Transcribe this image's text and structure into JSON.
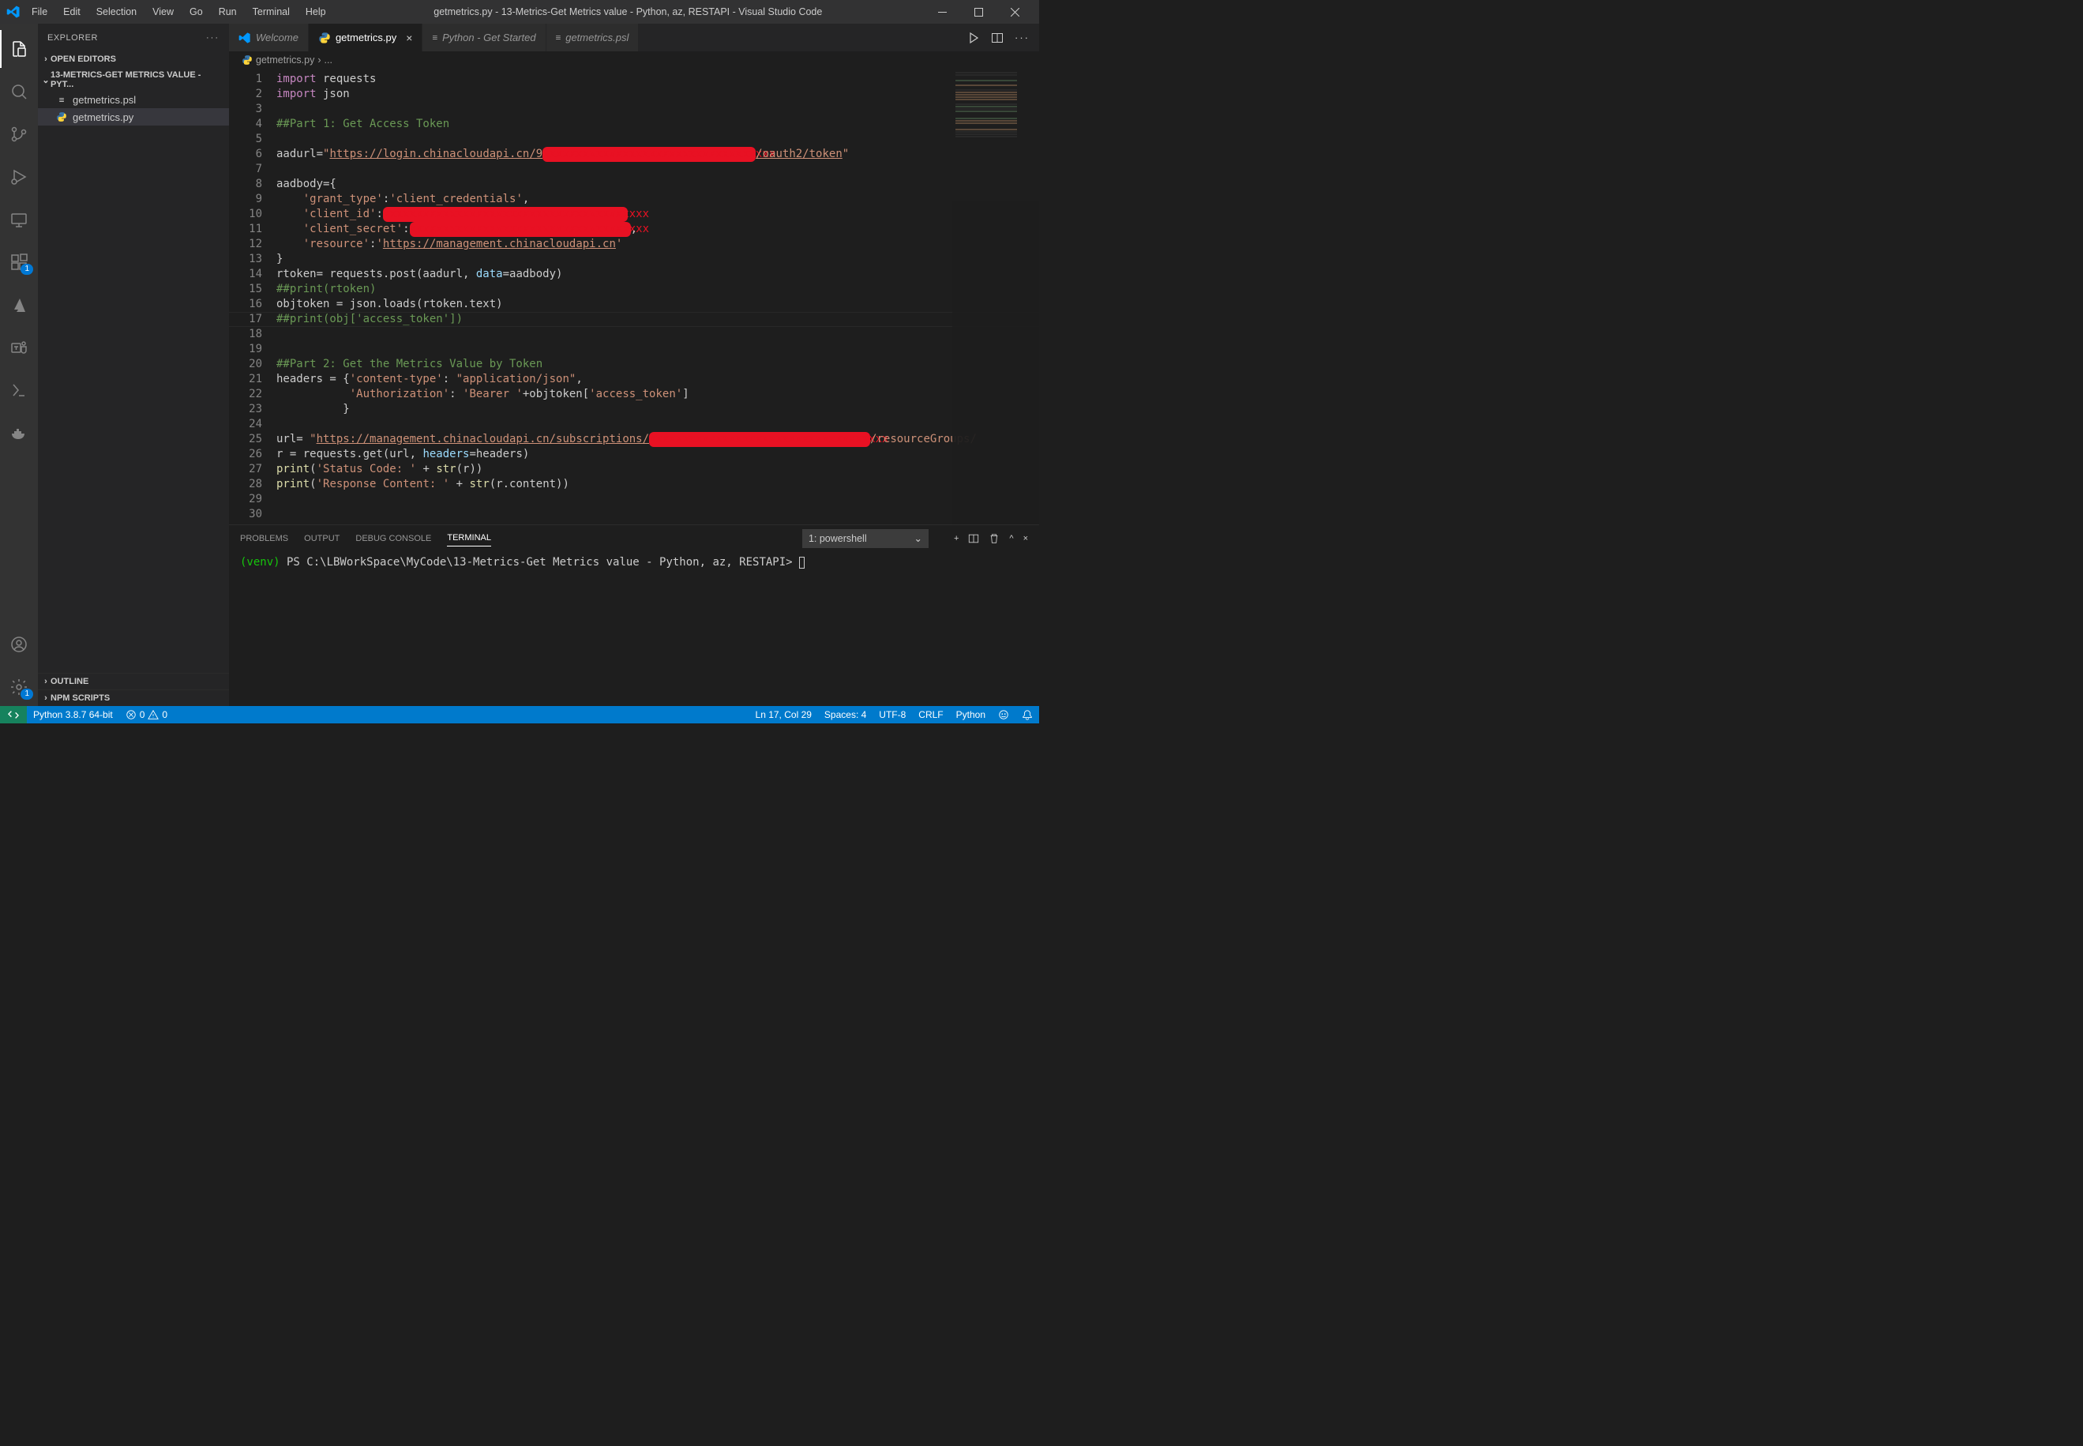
{
  "window": {
    "title": "getmetrics.py - 13-Metrics-Get Metrics value - Python, az, RESTAPI - Visual Studio Code"
  },
  "menu": {
    "file": "File",
    "edit": "Edit",
    "selection": "Selection",
    "view": "View",
    "go": "Go",
    "run": "Run",
    "terminal": "Terminal",
    "help": "Help"
  },
  "explorer": {
    "title": "EXPLORER",
    "open_editors": "OPEN EDITORS",
    "folder": "13-METRICS-GET METRICS VALUE - PYT...",
    "files": [
      {
        "name": "getmetrics.psl",
        "active": false,
        "icon": "≡"
      },
      {
        "name": "getmetrics.py",
        "active": true,
        "icon": "py"
      }
    ],
    "outline": "OUTLINE",
    "npm": "NPM SCRIPTS"
  },
  "tabs": {
    "items": [
      {
        "label": "Welcome",
        "icon": "vs",
        "active": false,
        "italic": true
      },
      {
        "label": "getmetrics.py",
        "icon": "py",
        "active": true,
        "italic": false,
        "close": true
      },
      {
        "label": "Python - Get Started",
        "icon": "≡",
        "active": false,
        "italic": true
      },
      {
        "label": "getmetrics.psl",
        "icon": "≡",
        "active": false,
        "italic": true
      }
    ]
  },
  "breadcrumb": {
    "file": "getmetrics.py",
    "rest": "..."
  },
  "code": {
    "lines": 30,
    "l1": {
      "a": "import",
      "b": " requests"
    },
    "l2": {
      "a": "import",
      "b": " json"
    },
    "l4": "##Part 1: Get Access Token",
    "l6": {
      "a": "aadurl=",
      "b": "\"",
      "c": "https://login.chinacloudapi.cn/9",
      "d": "/oauth2/token",
      "e": "\""
    },
    "l8": "aadbody={",
    "l9": {
      "a": "    ",
      "b": "'grant_type'",
      "c": ":",
      "d": "'client_credentials'",
      "e": ","
    },
    "l10": {
      "a": "    ",
      "b": "'client_id'",
      "c": ":"
    },
    "l11": {
      "a": "    ",
      "b": "'client_secret'",
      "c": ":",
      "d": ","
    },
    "l12": {
      "a": "    ",
      "b": "'resource'",
      "c": ":",
      "d": "'",
      "e": "https://management.chinacloudapi.cn",
      "f": "'"
    },
    "l13": "}",
    "l14": {
      "a": "rtoken= requests.post(aadurl, ",
      "b": "data",
      "c": "=aadbody)"
    },
    "l15": "##print(rtoken)",
    "l16": "objtoken = json.loads(rtoken.text)",
    "l17": "##print(obj['access_token'])",
    "l20": "##Part 2: Get the Metrics Value by Token",
    "l21": {
      "a": "headers = {",
      "b": "'content-type'",
      "c": ": ",
      "d": "\"application/json\"",
      "e": ","
    },
    "l22": {
      "a": "           ",
      "b": "'Authorization'",
      "c": ": ",
      "d": "'Bearer '",
      "e": "+objtoken[",
      "f": "'access_token'",
      "g": "]"
    },
    "l23": "          }",
    "l25": {
      "a": "url= ",
      "b": "\"",
      "c": "https://management.chinacloudapi.cn/subscriptions/",
      "d": "/resourceGroups/"
    },
    "l26": {
      "a": "r = requests.get(url, ",
      "b": "headers",
      "c": "=headers)"
    },
    "l27": {
      "a": "print",
      "b": "(",
      "c": "'Status Code: '",
      "d": " + ",
      "e": "str",
      "f": "(r))"
    },
    "l28": {
      "a": "print",
      "b": "(",
      "c": "'Response Content: '",
      "d": " + ",
      "e": "str",
      "f": "(r.content))"
    }
  },
  "panel": {
    "tabs": {
      "problems": "PROBLEMS",
      "output": "OUTPUT",
      "debug": "DEBUG CONSOLE",
      "terminal": "TERMINAL"
    },
    "shell_label": "1: powershell",
    "prompt": {
      "venv": "(venv)",
      "ps": " PS C:\\LBWorkSpace\\MyCode\\13-Metrics-Get Metrics value - Python, az, RESTAPI> "
    }
  },
  "status": {
    "python": "Python 3.8.7 64-bit",
    "errors": "0",
    "warnings": "0",
    "lncol": "Ln 17, Col 29",
    "spaces": "Spaces: 4",
    "encoding": "UTF-8",
    "eol": "CRLF",
    "lang": "Python"
  },
  "ext_badge": "1",
  "gear_badge": "1"
}
